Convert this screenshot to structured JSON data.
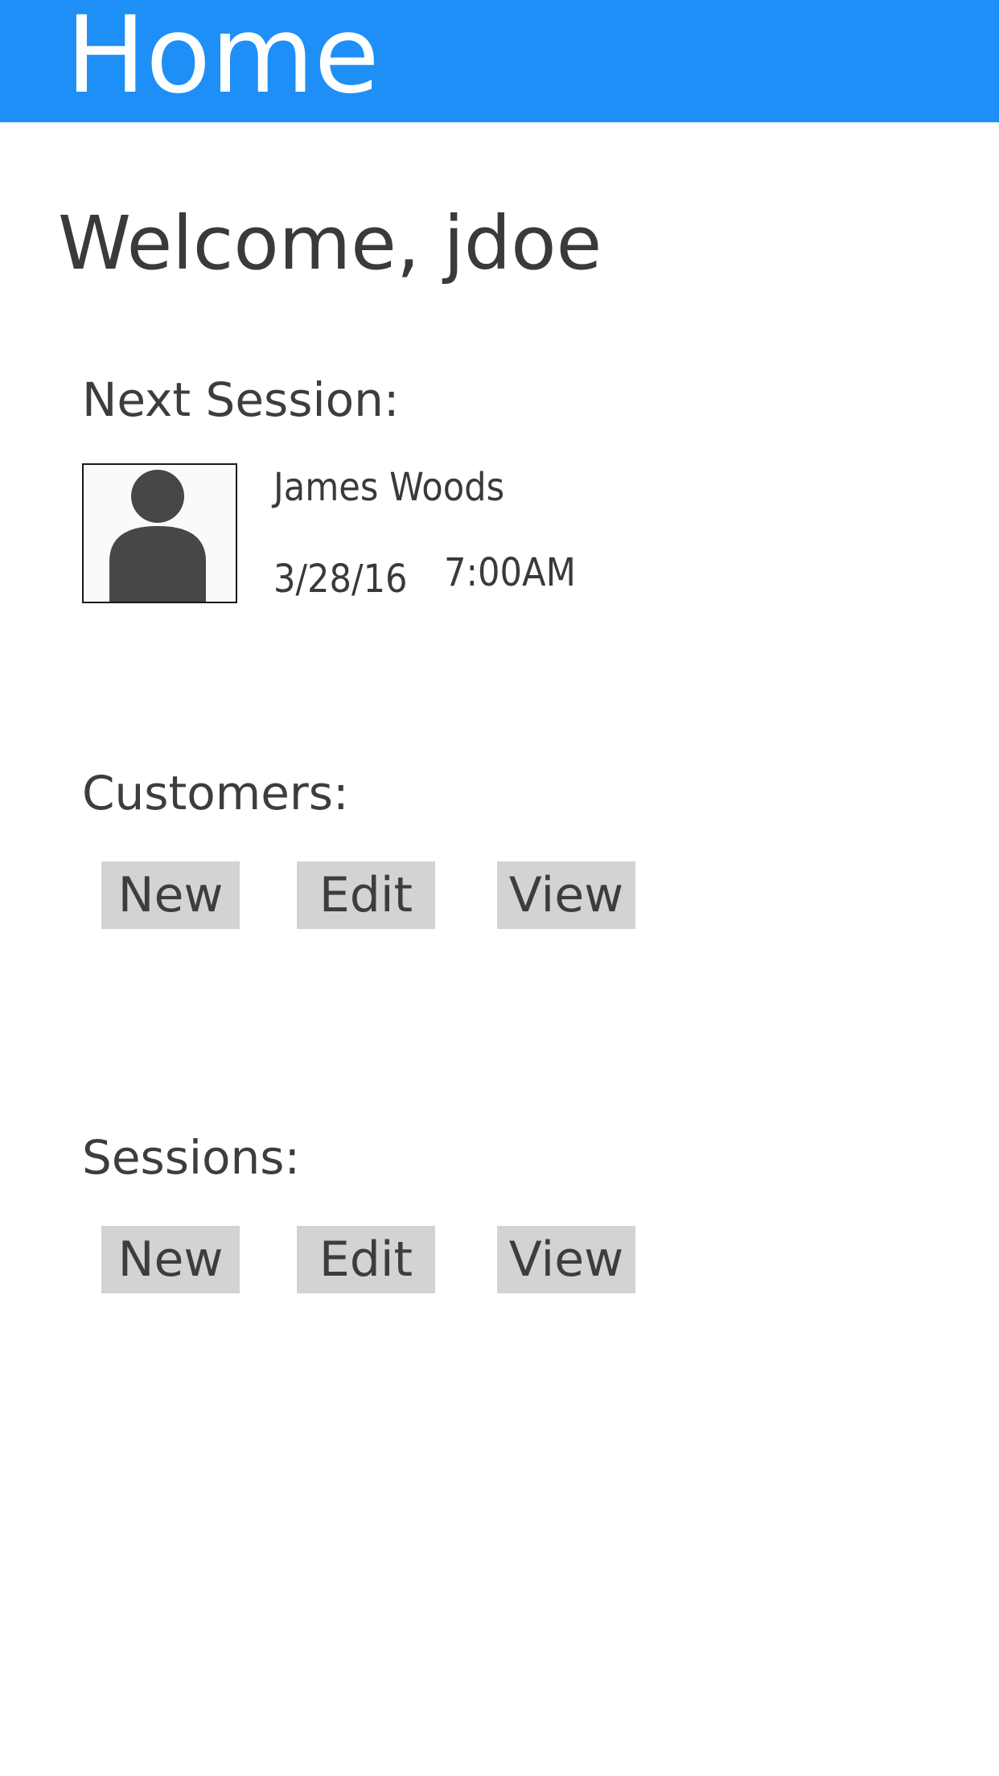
{
  "header": {
    "title": "Home",
    "background_color": "#1e8ff7"
  },
  "welcome": {
    "text": "Welcome, jdoe"
  },
  "next_session": {
    "label": "Next Session:",
    "avatar_icon": "person-icon",
    "customer_name": "James Woods",
    "date": "3/28/16",
    "time": "7:00AM"
  },
  "customers": {
    "label": "Customers:",
    "buttons": {
      "new": "New",
      "edit": "Edit",
      "view": "View"
    }
  },
  "sessions": {
    "label": "Sessions:",
    "buttons": {
      "new": "New",
      "edit": "Edit",
      "view": "View"
    }
  },
  "colors": {
    "button_background": "#d3d3d3",
    "text": "#3d3d3d"
  }
}
